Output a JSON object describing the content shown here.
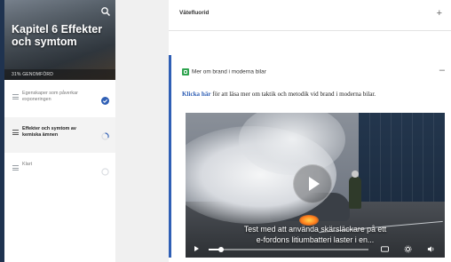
{
  "chapter": {
    "title": "Kapitel 6 Effekter och symtom",
    "progress_label": "31% GENOMFÖRD",
    "progress_fraction": 0.31
  },
  "nav": {
    "items": [
      {
        "label": "Egenskaper som påverkar exponeringen",
        "status": "completed"
      },
      {
        "label": "Effekter och symtom av kemiska ämnen",
        "status": "in-progress"
      },
      {
        "label": "Klart",
        "status": "not-started"
      }
    ]
  },
  "main": {
    "accordion_1_title": "Vätefluorid",
    "accordion_1_toggle": "+",
    "accordion_2_title": "Mer om brand i moderna bilar",
    "accordion_2_toggle": "–",
    "link_text": "Klicka här",
    "description_rest": " för att läsa mer om taktik och metodik vid brand i moderna bilar.",
    "video": {
      "subtitle_line_1": "Test med att använda skärsläckare på ett",
      "subtitle_line_2": "e-fordons litiumbatteri laster i en...",
      "progress_fraction": 0.08
    }
  },
  "colors": {
    "accent": "#2f5fb5",
    "sidebar_bg": "#ffffff",
    "page_bg": "#1f3350",
    "success": "#2fa44f"
  },
  "icons": {
    "search": "search-icon",
    "check": "check-circle-icon",
    "progress": "progress-ring-icon",
    "empty": "empty-circle-icon"
  }
}
